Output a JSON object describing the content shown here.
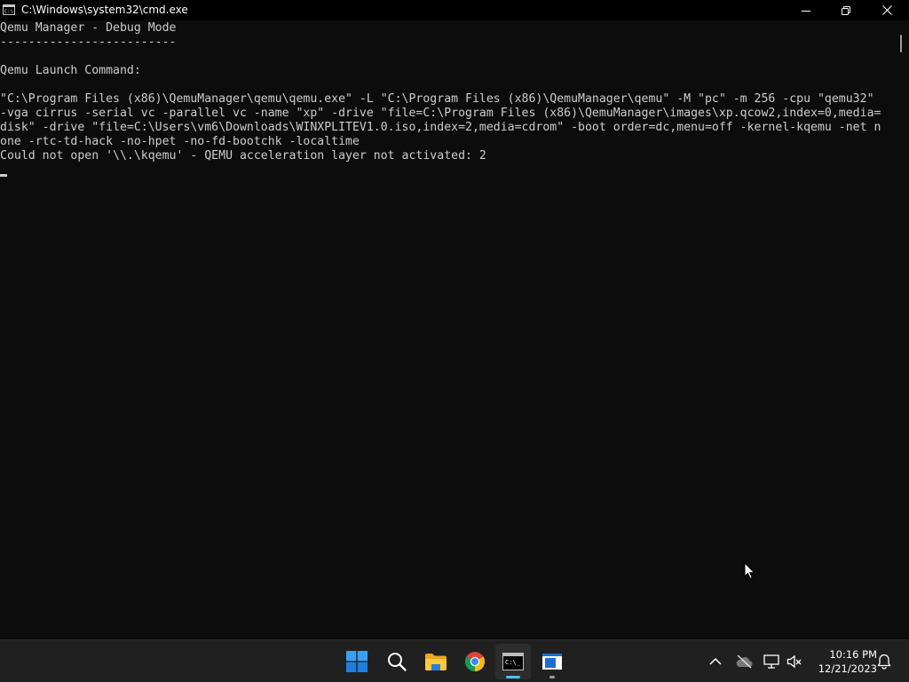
{
  "window": {
    "title": "C:\\Windows\\system32\\cmd.exe"
  },
  "console": {
    "lines": [
      "Qemu Manager - Debug Mode",
      "-------------------------",
      "",
      "Qemu Launch Command:",
      "",
      "\"C:\\Program Files (x86)\\QemuManager\\qemu\\qemu.exe\" -L \"C:\\Program Files (x86)\\QemuManager\\qemu\" -M \"pc\" -m 256 -cpu \"qemu32\"",
      "-vga cirrus -serial vc -parallel vc -name \"xp\" -drive \"file=C:\\Program Files (x86)\\QemuManager\\images\\xp.qcow2,index=0,media=",
      "disk\" -drive \"file=C:\\Users\\vm6\\Downloads\\WINXPLITEV1.0.iso,index=2,media=cdrom\" -boot order=dc,menu=off -kernel-kqemu -net n",
      "one -rtc-td-hack -no-hpet -no-fd-bootchk -localtime",
      "Could not open '\\\\.\\kqemu' - QEMU acceleration layer not activated: 2"
    ]
  },
  "taskbar": {
    "apps": [
      {
        "name": "start-button",
        "icon": "windows-logo-icon"
      },
      {
        "name": "search-button",
        "icon": "search-icon"
      },
      {
        "name": "file-explorer-button",
        "icon": "folder-icon"
      },
      {
        "name": "chrome-button",
        "icon": "chrome-icon"
      },
      {
        "name": "command-prompt-button",
        "icon": "terminal-icon"
      },
      {
        "name": "qemu-manager-button",
        "icon": "app-window-icon"
      }
    ],
    "tray": {
      "icons": [
        "chevron-up-icon",
        "cloud-offline-icon",
        "network-icon",
        "volume-muted-icon",
        "notification-bell-icon"
      ]
    },
    "clock": {
      "time": "10:16 PM",
      "date": "12/21/2023"
    }
  },
  "colors": {
    "console_bg": "#0c0c0c",
    "console_text": "#cccccc",
    "taskbar_bg": "#202020",
    "accent": "#4cc2ff"
  }
}
